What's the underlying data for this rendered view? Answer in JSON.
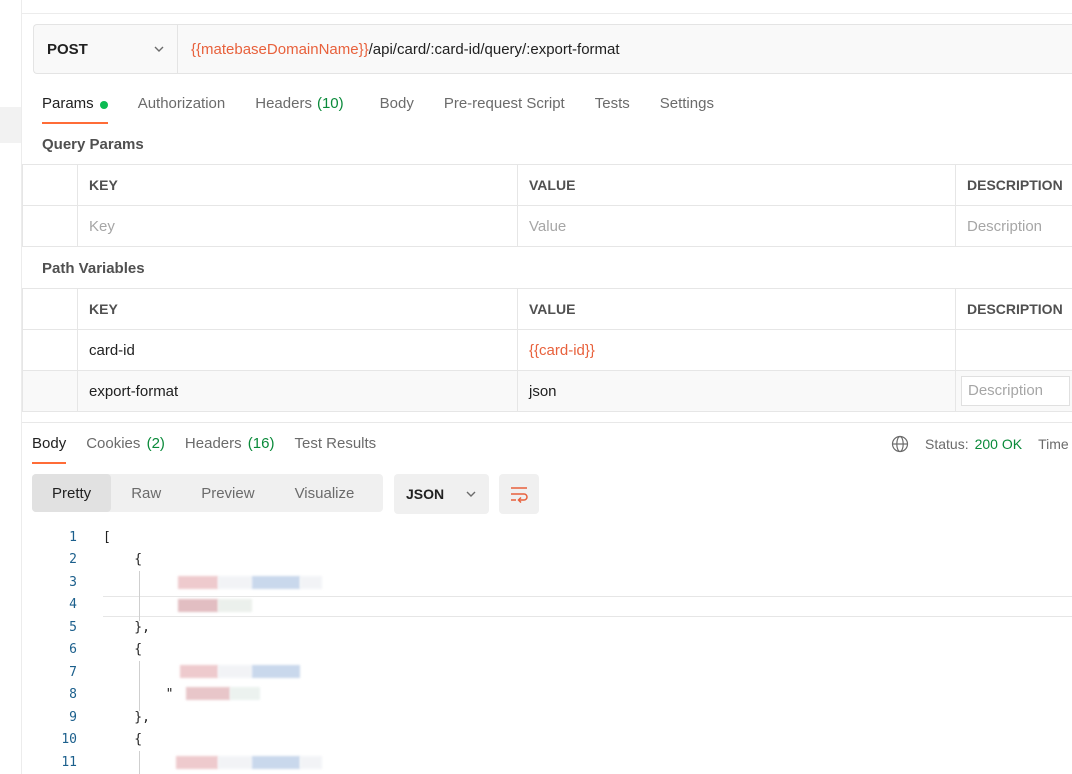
{
  "request": {
    "method": "POST",
    "url_var": "{{matebaseDomainName}}",
    "url_path": "/api/card/:card-id/query/:export-format",
    "tabs": [
      {
        "label": "Params",
        "active": true
      },
      {
        "label": "Authorization"
      },
      {
        "label": "Headers",
        "count": "(10)"
      },
      {
        "label": "Body"
      },
      {
        "label": "Pre-request Script"
      },
      {
        "label": "Tests"
      },
      {
        "label": "Settings"
      }
    ]
  },
  "query_params": {
    "title": "Query Params",
    "headers": {
      "key": "KEY",
      "value": "VALUE",
      "description": "DESCRIPTION"
    },
    "placeholder": {
      "key": "Key",
      "value": "Value",
      "description": "Description"
    }
  },
  "path_variables": {
    "title": "Path Variables",
    "headers": {
      "key": "KEY",
      "value": "VALUE",
      "description": "DESCRIPTION"
    },
    "rows": [
      {
        "key": "card-id",
        "value": "{{card-id}}",
        "description": ""
      },
      {
        "key": "export-format",
        "value": "json",
        "description_placeholder": "Description"
      }
    ]
  },
  "response": {
    "tabs": [
      {
        "label": "Body",
        "active": true
      },
      {
        "label": "Cookies",
        "count": "(2)"
      },
      {
        "label": "Headers",
        "count": "(16)"
      },
      {
        "label": "Test Results"
      }
    ],
    "status_label": "Status:",
    "status_value": "200 OK",
    "time_label": "Time",
    "view_modes": [
      "Pretty",
      "Raw",
      "Preview",
      "Visualize"
    ],
    "active_view": "Pretty",
    "format": "JSON"
  },
  "code": {
    "line_numbers": [
      "1",
      "2",
      "3",
      "4",
      "5",
      "6",
      "7",
      "8",
      "9",
      "10",
      "11"
    ],
    "lines": [
      "[",
      "    {",
      "",
      "",
      "    },",
      "    {",
      "",
      "        \"",
      "    },",
      "    {",
      ""
    ]
  },
  "colors": {
    "accent": "#ff6c37",
    "variable": "#e8613c",
    "success": "#0a8a3a",
    "dot": "#0cbb52"
  }
}
